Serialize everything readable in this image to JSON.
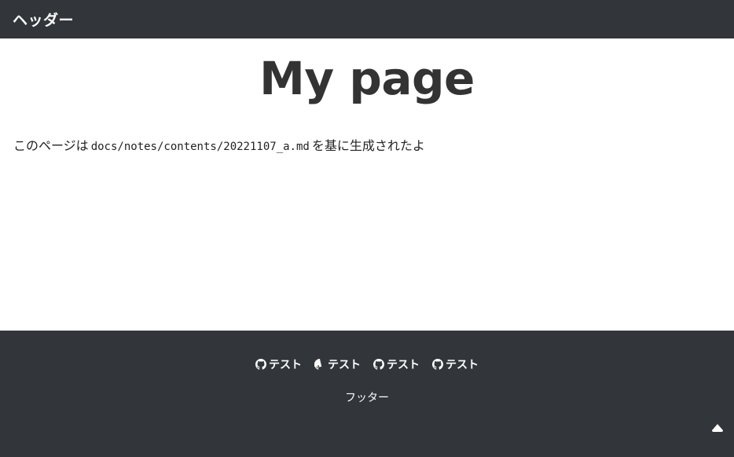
{
  "header": {
    "title": "ヘッダー"
  },
  "main": {
    "page_title": "My page",
    "text_before": "このページは",
    "path": "docs/notes/contents/20221107_a.md",
    "text_after": "を基に生成されたよ"
  },
  "footer": {
    "links": [
      {
        "label": "テスト",
        "icon": "github-icon"
      },
      {
        "label": "テスト",
        "icon": "github-icon"
      },
      {
        "label": "テスト",
        "icon": "github-icon"
      },
      {
        "label": "テスト",
        "icon": "github-icon"
      }
    ],
    "text": "フッター",
    "to_top_icon": "triangle-up-icon"
  },
  "colors": {
    "header_bg": "#32353a",
    "footer_bg": "#32353a",
    "title_text": "#333333"
  }
}
